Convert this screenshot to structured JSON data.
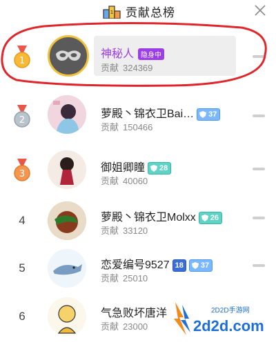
{
  "header": {
    "title": "贡献总榜",
    "podium_icon": "podium-icon",
    "close_icon": "close-icon"
  },
  "ranks": [
    {
      "rank": "1",
      "name": "神秘人",
      "tag": "隐身中",
      "contrib_label": "贡献",
      "contrib_value": "324369",
      "level": ""
    },
    {
      "rank": "2",
      "name": "萝殿丶锦衣卫Bai…",
      "contrib_label": "贡献",
      "contrib_value": "150466",
      "level": "37"
    },
    {
      "rank": "3",
      "name": "御姐卿瞳",
      "contrib_label": "贡献",
      "contrib_value": "40060",
      "level": "28"
    },
    {
      "rank": "4",
      "name": "萝殿丶锦衣卫Molxx",
      "contrib_label": "贡献",
      "contrib_value": "33120",
      "level": "26"
    },
    {
      "rank": "5",
      "name": "恋爱编号9527",
      "contrib_label": "贡献",
      "contrib_value": "25010",
      "level": "37",
      "extra_badge": "18"
    },
    {
      "rank": "6",
      "name": "气急败坏唐洋",
      "contrib_label": "贡献",
      "contrib_value": "23000",
      "level": ""
    }
  ],
  "watermark": {
    "site": "2D2D手游网",
    "url": "2d2d.com"
  },
  "colors": {
    "accent_purple": "#9b3ee8",
    "level_blue": "#7cb8ff",
    "level_teal": "#5fd3c5",
    "annotation_red": "#e0262b"
  }
}
